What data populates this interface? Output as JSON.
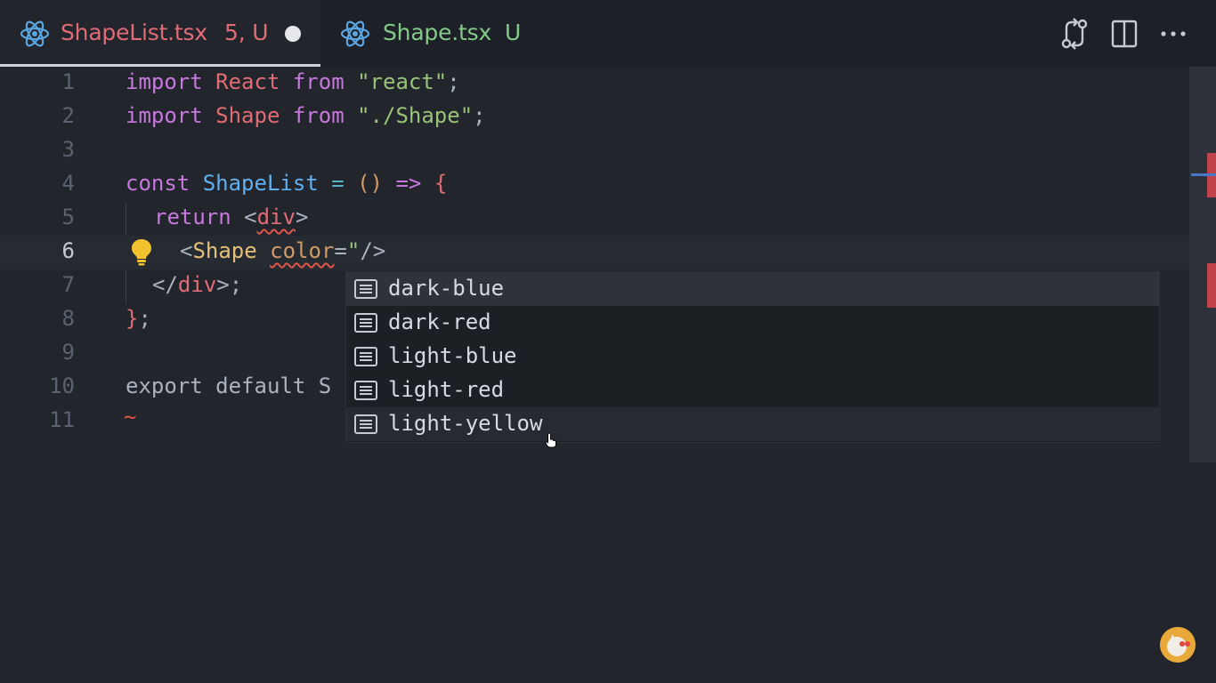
{
  "tabs": [
    {
      "name": "ShapeList.tsx",
      "status": "5, U",
      "dirty": true,
      "active": true
    },
    {
      "name": "Shape.tsx",
      "status": "U",
      "active": false
    }
  ],
  "toolbar": {
    "actions": [
      "source-control-diff-icon",
      "split-editor-icon",
      "more-actions-icon"
    ]
  },
  "editor": {
    "line_numbers": [
      "1",
      "2",
      "3",
      "4",
      "5",
      "6",
      "7",
      "8",
      "9",
      "10",
      "11"
    ],
    "current_line": "6",
    "lines": [
      {
        "kw": "import",
        "id": "React",
        "kw2": "from",
        "str": "\"react\"",
        "end": ";"
      },
      {
        "kw": "import",
        "id": "Shape",
        "kw2": "from",
        "str": "\"./Shape\"",
        "end": ";"
      },
      {},
      {
        "kw": "const",
        "id": "ShapeList",
        "op1": "=",
        "paren": "()",
        "arrow": "=>",
        "brace": "{"
      },
      {
        "kw": "return",
        "open": "<",
        "tag": "div",
        "close": ">"
      },
      {
        "open": "<",
        "tag": "Shape",
        "attr": "color",
        "eq": "=",
        "quote": "\"",
        "end": "/>"
      },
      {
        "open": "</",
        "tag": "div",
        "end": ">;"
      },
      {
        "brace": "}",
        "end": ";"
      },
      {},
      {
        "text": "export default S"
      },
      {
        "squiggle": "~"
      }
    ]
  },
  "suggest": {
    "items": [
      {
        "label": "dark-blue",
        "icon": "text-icon"
      },
      {
        "label": "dark-red",
        "icon": "text-icon"
      },
      {
        "label": "light-blue",
        "icon": "text-icon"
      },
      {
        "label": "light-red",
        "icon": "text-icon"
      },
      {
        "label": "light-yellow",
        "icon": "text-icon"
      }
    ],
    "selected": "dark-blue"
  },
  "colors": {
    "keyword": "#c678dd",
    "string": "#98c379",
    "error": "#e06c75",
    "untracked": "#84c98a"
  }
}
